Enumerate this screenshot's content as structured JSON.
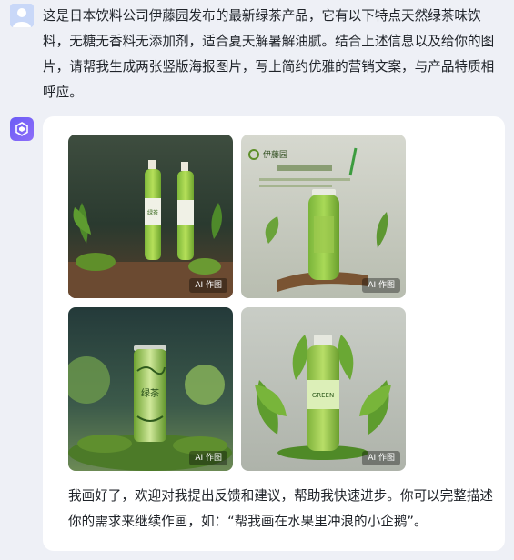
{
  "user_message": {
    "text": "这是日本饮料公司伊藤园发布的最新绿茶产品，它有以下特点天然绿茶味饮料，无糖无香料无添加剂，适合夏天解暑解油腻。结合上述信息以及给你的图片，请帮我生成两张竖版海报图片，写上简约优雅的营销文案，与产品特质相呼应。"
  },
  "bot_message": {
    "images": [
      {
        "tag": "AI 作图",
        "label_text": "绿茶"
      },
      {
        "tag": "AI 作图",
        "label_text": "伊藤园"
      },
      {
        "tag": "AI 作图",
        "label_text": "绿茶"
      },
      {
        "tag": "AI 作图",
        "label_text": "GREEN"
      }
    ],
    "text": "我画好了，欢迎对我提出反馈和建议，帮助我快速进步。你可以完整描述你的需求来继续作画，如：“帮我画在水果里冲浪的小企鹅”。"
  },
  "icons": {
    "user_avatar": "user-avatar-icon",
    "bot_avatar": "bot-logo-icon"
  },
  "colors": {
    "background": "#eef0f6",
    "card": "#ffffff",
    "bot_avatar": "#7a63f7",
    "user_avatar": "#c9d8f8"
  }
}
